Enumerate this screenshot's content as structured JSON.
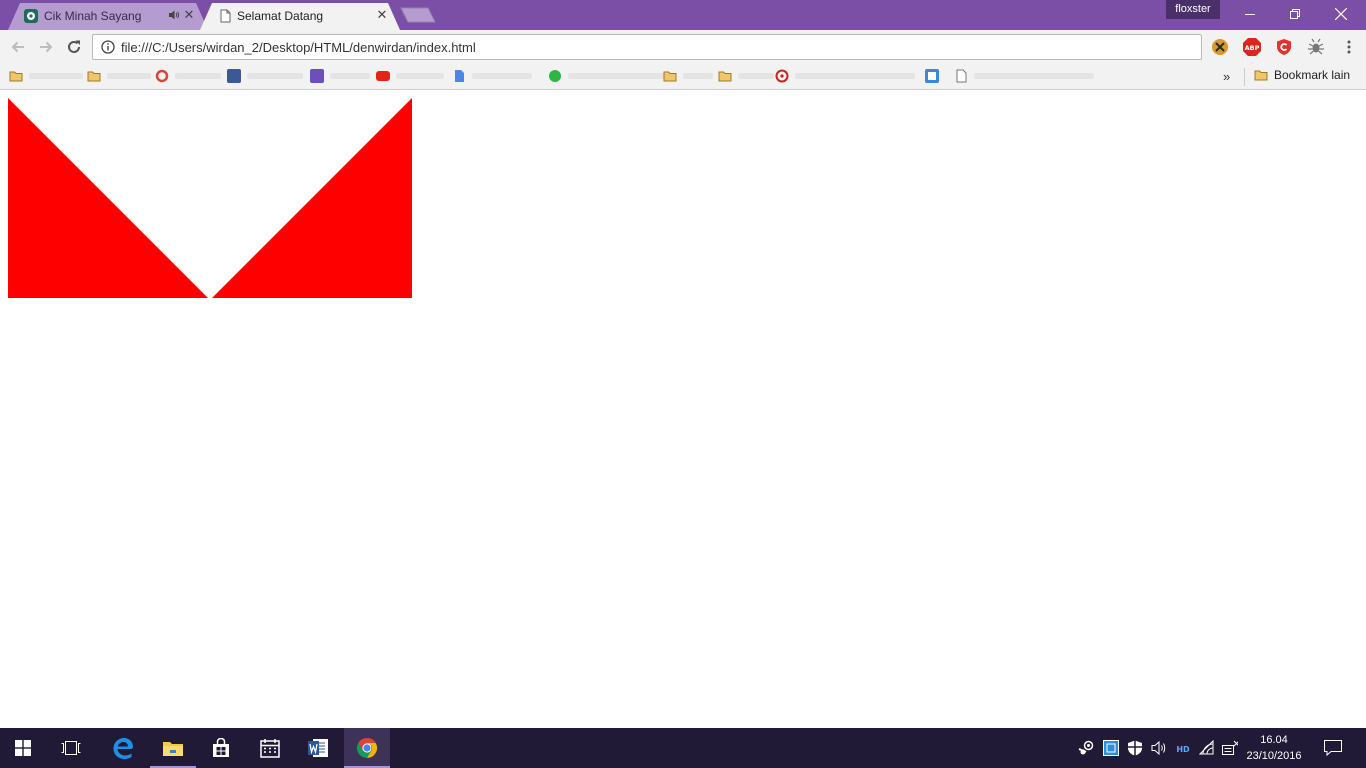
{
  "browser": {
    "tabs": [
      {
        "title": "Cik Minah Sayang",
        "active": false,
        "audio": true
      },
      {
        "title": "Selamat Datang",
        "active": true,
        "audio": false
      }
    ],
    "profile_name": "floxster",
    "address_bar": {
      "url": "file:///C:/Users/wirdan_2/Desktop/HTML/denwirdan/index.html"
    },
    "bookmarks": {
      "overflow_label": "»",
      "other_bookmarks_label": "Bookmark lain"
    }
  },
  "page": {
    "shapes": [
      {
        "type": "right-triangle",
        "color": "#ff0000"
      },
      {
        "type": "right-triangle",
        "color": "#ff0000"
      }
    ]
  },
  "taskbar": {
    "clock": {
      "time": "16.04",
      "date": "23/10/2016"
    }
  },
  "colors": {
    "titlebar": "#7b4fa6",
    "taskbar": "#201a36",
    "shape_fill": "#ff0000"
  }
}
